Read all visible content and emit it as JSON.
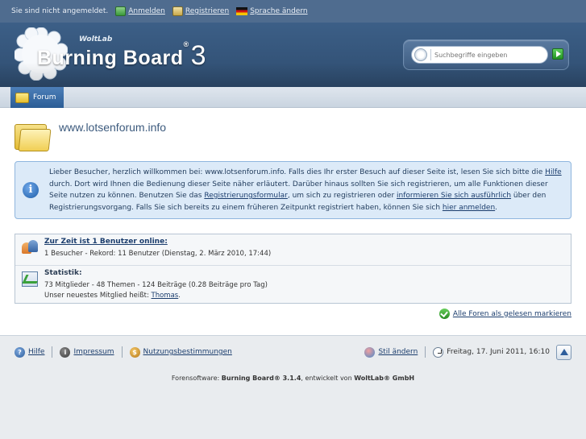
{
  "userbar": {
    "status": "Sie sind nicht angemeldet.",
    "login": "Anmelden",
    "register": "Registrieren",
    "language": "Sprache ändern",
    "icons": [
      "login-icon",
      "register-icon",
      "flag-germany-icon"
    ]
  },
  "header": {
    "logo_sub": "WoltLab",
    "logo_main": "Burning Board",
    "logo_reg": "®",
    "logo_num": "3",
    "search_placeholder": "Suchbegriffe eingeben",
    "search_value": "Suchbegriffe eingeben"
  },
  "nav": {
    "forum_tab": "Forum"
  },
  "page": {
    "title": "www.lotsenforum.info"
  },
  "info": {
    "t1": "Lieber Besucher, herzlich willkommen bei: www.lotsenforum.info. Falls dies Ihr erster Besuch auf dieser Seite ist, lesen Sie sich bitte die ",
    "help_link": "Hilfe",
    "t2": " durch. Dort wird Ihnen die Bedienung dieser Seite näher erläutert. Darüber hinaus sollten Sie sich registrieren, um alle Funktionen dieser Seite nutzen zu können. Benutzen Sie das ",
    "reg_link": "Registrierungsformular",
    "t3": ", um sich zu registrieren oder ",
    "more_link": "informieren Sie sich ausführlich",
    "t4": " über den Registrierungsvorgang. Falls Sie sich bereits zu einem früheren Zeitpunkt registriert haben, können Sie sich ",
    "login_link": "hier anmelden",
    "t5": "."
  },
  "stats": {
    "online_head": "Zur Zeit ist 1 Benutzer online:",
    "online_line": "1 Besucher - Rekord: 11 Benutzer (Dienstag, 2. März 2010, 17:44)",
    "stats_head": "Statistik:",
    "stats_line": "73 Mitglieder - 48 Themen - 124 Beiträge (0.28 Beiträge pro Tag)",
    "newest_prefix": "Unser neuestes Mitglied heißt: ",
    "newest_member": "Thomas",
    "newest_suffix": "."
  },
  "markread": "Alle Foren als gelesen markieren",
  "footer": {
    "help": "Hilfe",
    "imprint": "Impressum",
    "terms": "Nutzungsbestimmungen",
    "style": "Stil ändern",
    "date": "Freitag, 17. Juni 2011, 16:10",
    "copy_prefix": "Forensoftware: ",
    "copy_product": "Burning Board® 3.1.4",
    "copy_mid": ", entwickelt von ",
    "copy_vendor": "WoltLab® GmbH"
  }
}
